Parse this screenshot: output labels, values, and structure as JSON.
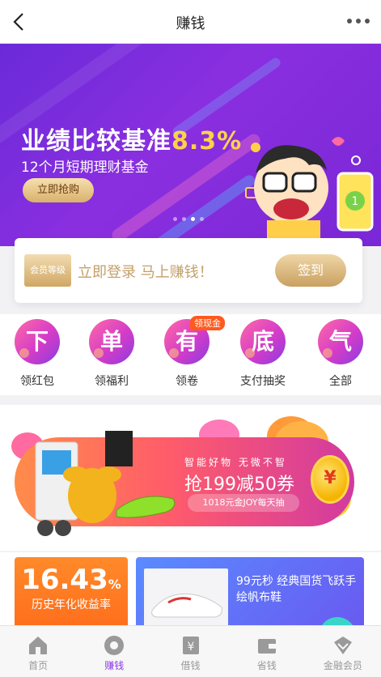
{
  "nav": {
    "title": "赚钱",
    "back_icon": "back-arrow-icon",
    "more_icon": "more-dots-icon"
  },
  "banner": {
    "headline_prefix": "业绩比较基准",
    "headline_value": "8.3%",
    "subtitle": "12个月短期理财基金",
    "button_label": "立即抢购",
    "slide_count": 4,
    "active_slide": 3
  },
  "member": {
    "badge_label": "会员等级",
    "prompt": "立即登录 马上赚钱！",
    "signin_label": "签到"
  },
  "quick_entries": [
    {
      "glyph": "下",
      "label": "领红包"
    },
    {
      "glyph": "单",
      "label": "领福利"
    },
    {
      "glyph": "有",
      "label": "领卷",
      "tag": "领现金"
    },
    {
      "glyph": "底",
      "label": "支付抽奖"
    },
    {
      "glyph": "气",
      "label": "全部"
    }
  ],
  "promo": {
    "small_text": "智能好物 无微不智",
    "main_text": "抢199减50券",
    "pill_text": "1018元金JOY每天抽",
    "coin_symbol": "¥"
  },
  "products": {
    "rate_value": "16.43",
    "rate_unit": "%",
    "rate_label": "历史年化收益率",
    "card_text": "99元秒 经典国货飞跃手绘帆布鞋"
  },
  "tabbar": [
    {
      "label": "首页",
      "icon": "home-icon",
      "active": false
    },
    {
      "label": "赚钱",
      "icon": "earn-icon",
      "active": true
    },
    {
      "label": "借钱",
      "icon": "borrow-icon",
      "active": false
    },
    {
      "label": "省钱",
      "icon": "wallet-icon",
      "active": false
    },
    {
      "label": "金融会员",
      "icon": "vip-diamond-icon",
      "active": false
    }
  ],
  "colors": {
    "accent": "#8a3be6",
    "banner": "#7a2be0",
    "gold": "#c9a061",
    "orange": "#ff6a1a"
  }
}
